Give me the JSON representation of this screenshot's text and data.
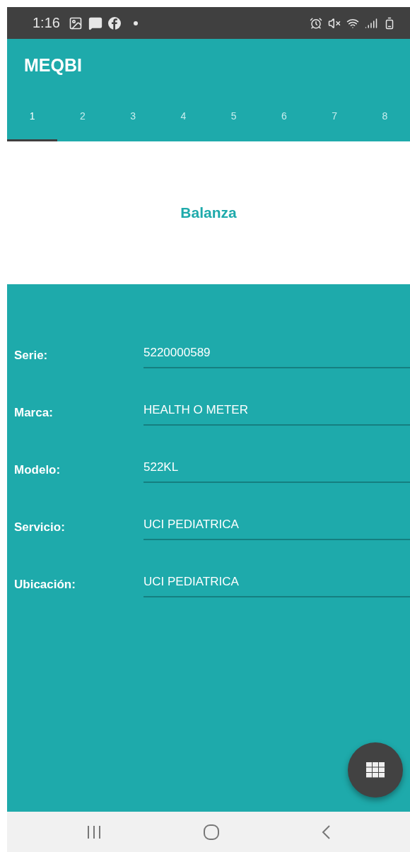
{
  "status_bar": {
    "time": "1:16"
  },
  "app_bar": {
    "title": "MEQBI"
  },
  "tabs": [
    {
      "label": "1",
      "selected": true
    },
    {
      "label": "2",
      "selected": false
    },
    {
      "label": "3",
      "selected": false
    },
    {
      "label": "4",
      "selected": false
    },
    {
      "label": "5",
      "selected": false
    },
    {
      "label": "6",
      "selected": false
    },
    {
      "label": "7",
      "selected": false
    },
    {
      "label": "8",
      "selected": false
    }
  ],
  "heading": "Balanza",
  "fields": [
    {
      "label": "Serie:",
      "value": "5220000589"
    },
    {
      "label": "Marca:",
      "value": "HEALTH O METER"
    },
    {
      "label": "Modelo:",
      "value": "522KL"
    },
    {
      "label": "Servicio:",
      "value": "UCI PEDIATRICA"
    },
    {
      "label": "Ubicación:",
      "value": "UCI PEDIATRICA"
    }
  ]
}
